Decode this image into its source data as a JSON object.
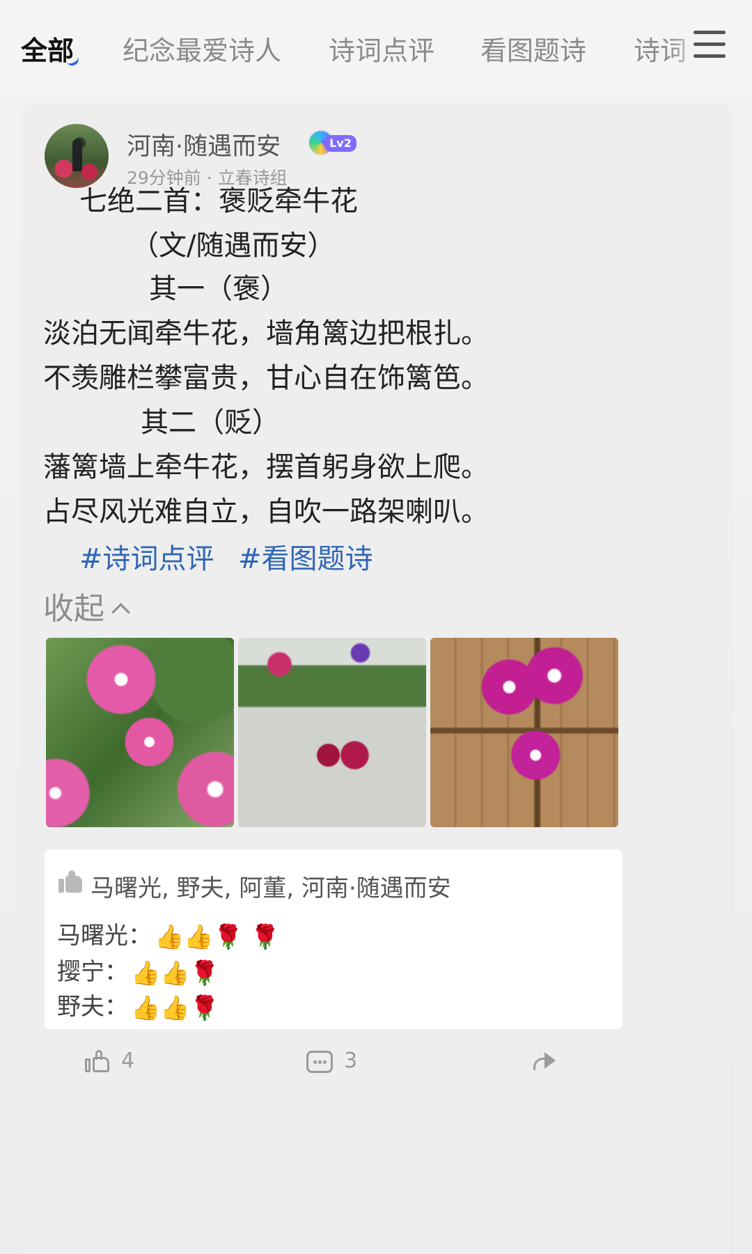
{
  "tabs": [
    {
      "label": "全部",
      "active": true
    },
    {
      "label": "纪念最爱诗人",
      "active": false
    },
    {
      "label": "诗词点评",
      "active": false
    },
    {
      "label": "看图题诗",
      "active": false
    },
    {
      "label": "诗词",
      "active": false
    }
  ],
  "post": {
    "author": "河南·随遇而安",
    "level": "Lv2",
    "time": "29分钟前",
    "group": "立春诗组",
    "poem_lines": [
      "七绝二首：褒贬牵牛花",
      "（文/随遇而安）",
      "其一（褒）",
      "淡泊无闻牵牛花，墙角篱边把根扎。",
      "不羡雕栏攀富贵，甘心自在饰篱笆。",
      "其二（贬）",
      "藩篱墙上牵牛花，摆首躬身欲上爬。",
      "占尽风光难自立，自吹一路架喇叭。"
    ],
    "tags": [
      "#诗词点评",
      "#看图题诗"
    ],
    "collapse_label": "收起",
    "images": [
      "pink-morning-glory-photo",
      "planter-morning-glory-photo",
      "purple-morning-glory-photo"
    ],
    "likers": "马曙光, 野夫, 阿董, 河南·随遇而安",
    "comments": [
      {
        "name": "马曙光：",
        "emoji": "👍👍🌹 🌹"
      },
      {
        "name": "撄宁：",
        "emoji": "👍👍🌹"
      },
      {
        "name": "野夫：",
        "emoji": "👍👍🌹"
      }
    ],
    "like_count": "4",
    "comment_count": "3"
  },
  "colors": {
    "accent": "#2a66e8",
    "tag": "#2f66b5",
    "level_badge": "#7d6bff"
  },
  "icons": [
    "menu-icon",
    "level-badge-icon",
    "thumbs-up-icon",
    "comment-icon",
    "share-icon"
  ]
}
